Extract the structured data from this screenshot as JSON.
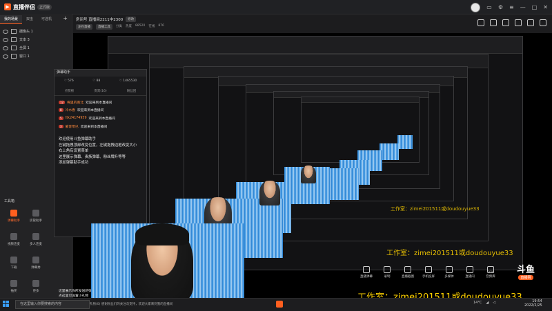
{
  "app": {
    "name": "直播伴侣",
    "version_badge": "正式版"
  },
  "window_controls": [
    "▭",
    "⚙",
    "≡",
    "—",
    "□",
    "✕"
  ],
  "scene_tabs": {
    "items": [
      "我的场景",
      "双击",
      "可选机"
    ],
    "active": 0,
    "add_label": "+"
  },
  "sources": [
    {
      "label": "摄像头 1"
    },
    {
      "label": "文本 3"
    },
    {
      "label": "全屏 1"
    },
    {
      "label": "窗口 1"
    }
  ],
  "tools": {
    "title": "工具箱",
    "items": [
      {
        "label": "弹幕助手",
        "highlight": true
      },
      {
        "label": "房管助手",
        "highlight": false
      },
      {
        "label": "视频连麦",
        "highlight": false
      },
      {
        "label": "多人连麦",
        "highlight": false
      },
      {
        "label": "下载",
        "highlight": false
      },
      {
        "label": "弹幕秀",
        "highlight": false
      },
      {
        "label": "抽奖",
        "highlight": false
      },
      {
        "label": "更多",
        "highlight": false
      }
    ]
  },
  "stream": {
    "title": "房间号 直播间2211中2300",
    "title_tag": "修改",
    "meta": [
      "正在直播",
      "直播工具",
      "分类",
      "热度",
      "88520",
      "在线",
      "876"
    ]
  },
  "chat": {
    "header": "弹幕助手",
    "stats": [
      "♡ 576",
      "♡ 88",
      "♡ 1465530"
    ],
    "tabs": [
      "点赞榜",
      "贵宾(16)",
      "粉丝团"
    ],
    "rows": [
      {
        "lv": "12",
        "nick": "梅里的南北",
        "msg": "欢迎来到本直播间"
      },
      {
        "lv": "8",
        "nick": "冷水香",
        "msg": "欢迎来到本直播间"
      },
      {
        "lv": "5",
        "nick": "ttk24174959",
        "msg": "欢迎来到本直播间"
      },
      {
        "lv": "3",
        "nick": "蒙客零已",
        "msg": "欢迎来到本直播间"
      }
    ],
    "help_text": "欢迎使用斗鱼弹幕助手\n左键拖拽顶部改变位置，左键拖拽边框改变大小\n右上角有设置菜单\n这里展示弹幕、贵族弹幕、粉丝牌升等等\n添加弹幕助手成功",
    "footer_text": "这里展示你所发送的弹幕、道具、贵族进场\n点这里可设置小礼物"
  },
  "bottom_tools": [
    "直播弹幕",
    "录制",
    "直播截图",
    "手机投屏",
    "多媒体",
    "直播间",
    "音频库"
  ],
  "watermark": "工作室：zimei201511或doudouyue33",
  "douyu_logo": {
    "big": "斗鱼",
    "small": "直播网"
  },
  "net_status": "60%",
  "status_bar": {
    "message": "礼物(0)  感谢粉丝们的关注与支持，欢迎大家来到我的直播间"
  },
  "taskbar": {
    "search_placeholder": "在这里输入你要搜索的内容",
    "weather": "14°C",
    "time": "19:54",
    "date": "2022/2/25"
  }
}
